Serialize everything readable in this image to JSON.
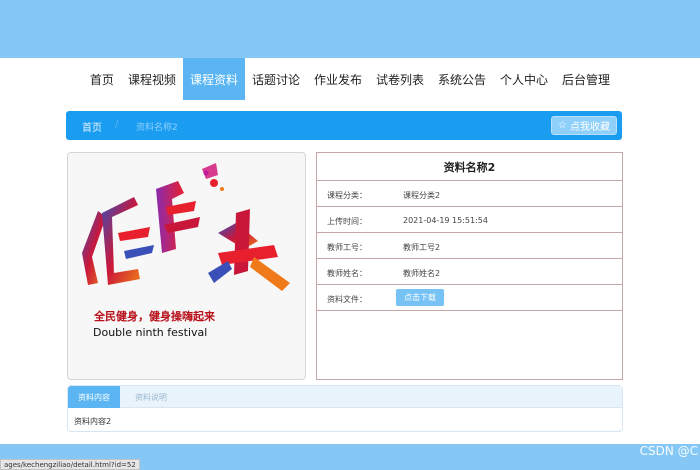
{
  "nav": {
    "items": [
      {
        "label": "首页",
        "active": false
      },
      {
        "label": "课程视频",
        "active": false
      },
      {
        "label": "课程资料",
        "active": true
      },
      {
        "label": "话题讨论",
        "active": false
      },
      {
        "label": "作业发布",
        "active": false
      },
      {
        "label": "试卷列表",
        "active": false
      },
      {
        "label": "系统公告",
        "active": false
      },
      {
        "label": "个人中心",
        "active": false
      },
      {
        "label": "后台管理",
        "active": false
      }
    ]
  },
  "breadcrumb": {
    "home": "首页",
    "separator": "/",
    "current": "资料名称2",
    "favorite_icon": "☆",
    "favorite_label": "点我收藏"
  },
  "poster": {
    "line1": "全民健身，健身操嗨起来",
    "line2": "Double ninth festival",
    "headline_chars": [
      "健",
      "身",
      "操"
    ]
  },
  "info": {
    "title": "资料名称2",
    "rows": [
      {
        "label": "课程分类：",
        "value": "课程分类2"
      },
      {
        "label": "上传时间：",
        "value": "2021-04-19 15:51:54"
      },
      {
        "label": "教师工号：",
        "value": "教师工号2"
      },
      {
        "label": "教师姓名：",
        "value": "教师姓名2"
      }
    ],
    "file_label": "资料文件：",
    "download_label": "点击下载"
  },
  "tabs": {
    "items": [
      "资料内容",
      "资料说明"
    ],
    "content": "资料内容2"
  },
  "status_url": "ages/kechengziliao/detail.html?id=52",
  "watermark": "CSDN @C",
  "colors": {
    "header_band": "#85c8f6",
    "accent": "#1a9cf0",
    "active_nav": "#5ab5f2"
  }
}
